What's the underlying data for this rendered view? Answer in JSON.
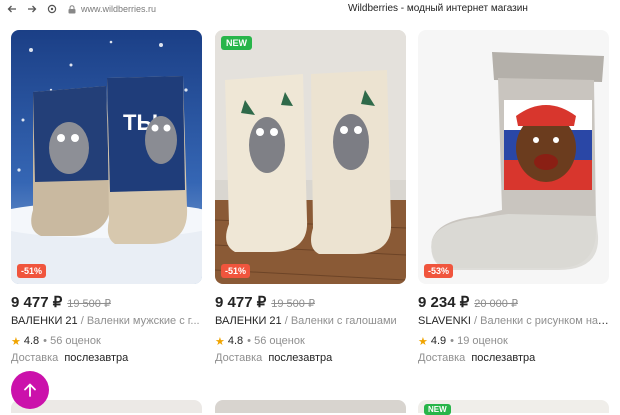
{
  "browser": {
    "url": "www.wildberries.ru",
    "page_title": "Wildberries - модный интернет магазин"
  },
  "products": [
    {
      "badge_new": "",
      "discount": "-51%",
      "price": "9 477 ₽",
      "old_price": "19 500 ₽",
      "brand": "ВАЛЕНКИ 21",
      "name": " / Валенки мужские с г...",
      "rating": "4.8",
      "reviews": "• 56 оценок",
      "delivery_label": "Доставка",
      "delivery_when": "послезавтра"
    },
    {
      "badge_new": "NEW",
      "discount": "-51%",
      "price": "9 477 ₽",
      "old_price": "19 500 ₽",
      "brand": "ВАЛЕНКИ 21",
      "name": " / Валенки с галошами",
      "rating": "4.8",
      "reviews": "• 56 оценок",
      "delivery_label": "Доставка",
      "delivery_when": "послезавтра"
    },
    {
      "badge_new": "",
      "discount": "-53%",
      "price": "9 234 ₽",
      "old_price": "20 000 ₽",
      "brand": "SLAVENKI",
      "name": " / Валенки с рисунком нат...",
      "rating": "4.9",
      "reviews": "• 19 оценок",
      "delivery_label": "Доставка",
      "delivery_when": "послезавтра"
    }
  ],
  "next_row": {
    "badge_new": "NEW"
  },
  "icons": {
    "back": "arrow-left-icon",
    "forward": "arrow-right-icon",
    "reload": "reload-icon",
    "lock": "lock-icon",
    "star": "star-icon",
    "scroll_top": "arrow-up-icon"
  },
  "colors": {
    "brand_purple": "#cb11ab",
    "new_badge": "#28b54a",
    "discount_badge": "#f0553d",
    "star": "#f0a400"
  }
}
